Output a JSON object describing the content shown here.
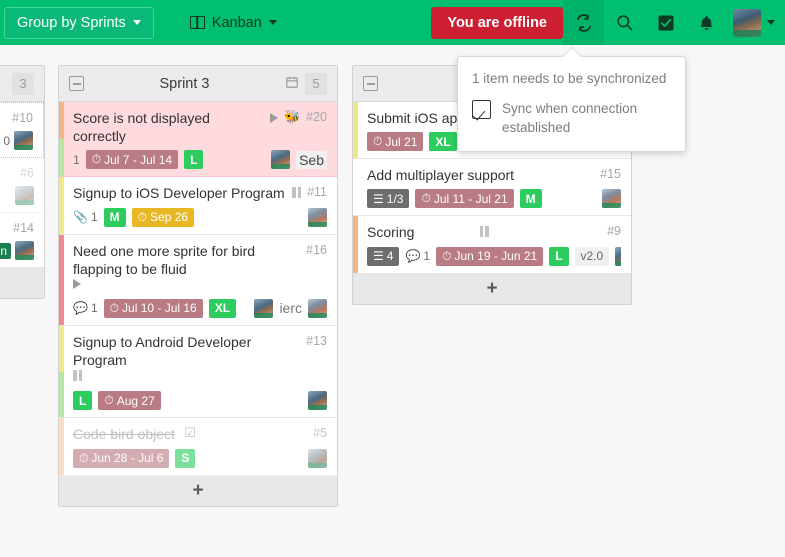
{
  "topbar": {
    "group_button": {
      "label": "Group by Sprints",
      "icon": "chevron-down-icon",
      "bg": "#0ab878"
    },
    "view_button": {
      "label": "Kanban",
      "icon": "kanban-icon"
    },
    "offline_badge": {
      "label": "You are offline",
      "bg": "#cc1f32"
    },
    "icons": [
      {
        "name": "sync-icon",
        "glyph": "↻",
        "active": true
      },
      {
        "name": "search-icon",
        "glyph": "⌕",
        "active": false
      },
      {
        "name": "tasks-checkbox-icon",
        "glyph": "☑",
        "active": false
      },
      {
        "name": "notifications-bell-icon",
        "glyph": "ὑ4",
        "active": false
      }
    ],
    "avatar": {
      "name": "user-avatar",
      "caret": "chevron-down-icon"
    },
    "accent": "#00c070"
  },
  "sync_popover": {
    "title": "1 item needs to be synchronized",
    "checkbox_label": "Sync when connection established",
    "checked": true
  },
  "columns": [
    {
      "id": "col-left",
      "title": "",
      "count": "3",
      "cards": [
        {
          "id": "#10",
          "title": "",
          "dotted": true,
          "extra": "0"
        },
        {
          "id": "#6",
          "title": "",
          "dim": true
        },
        {
          "id": "#14",
          "title": "",
          "tag": "n"
        }
      ]
    },
    {
      "id": "sprint-3",
      "title": "Sprint 3",
      "calendar_icon": "calendar-icon",
      "count": "5",
      "cards": [
        {
          "title": "Score is not displayed correctly",
          "id": "#20",
          "highlighted": true,
          "stripes": [
            "#f5b687",
            "#b5e8a0"
          ],
          "play": true,
          "bug": true,
          "comments": "1",
          "date": "Jul 7 - Jul 14",
          "date_style": "date",
          "size": "L",
          "avatars": 1,
          "assignee": "Seb"
        },
        {
          "title": "Signup to iOS Developer Program",
          "id": "#11",
          "stripes": [
            "#f0e98a"
          ],
          "pause": true,
          "attachments": "1",
          "size": "M",
          "date": "Sep 26",
          "date_style": "date-y",
          "avatars": 1
        },
        {
          "title": "Need one more sprite for bird flapping to be fluid",
          "id": "#16",
          "stripes": [
            "#f08a90"
          ],
          "play": true,
          "comments": "1",
          "date": "Jul 10 - Jul 16",
          "date_style": "date",
          "size": "XL",
          "avatars": 3,
          "assignee_fragment": "ierc"
        },
        {
          "title": "Signup to Android Developer Program",
          "id": "#13",
          "stripes": [
            "#f0e98a",
            "#b5e8a0"
          ],
          "pause": true,
          "size": "L",
          "date": "Aug 27",
          "date_style": "date",
          "avatars": 1
        },
        {
          "title": "Code bird object",
          "id": "#5",
          "done": true,
          "stripes": [
            "#f7c9a6"
          ],
          "check": true,
          "date": "Jun 28 - Jul 6",
          "date_style": "date",
          "size": "S",
          "avatars": 1
        }
      ],
      "footer_add": "+"
    },
    {
      "id": "col-two",
      "title": "",
      "count": "",
      "cards": [
        {
          "title": "Submit iOS app",
          "id": "",
          "stripes": [
            "#f0e98a"
          ],
          "date": "Jul 21",
          "date_style": "date",
          "size": "XL",
          "avatars": 0
        },
        {
          "title": "Add multiplayer support",
          "id": "#15",
          "stripes": [
            "#ffffff"
          ],
          "checklist": "1/3",
          "date": "Jul 11 - Jul 21",
          "date_style": "date",
          "size": "M",
          "avatars": 1
        },
        {
          "title": "Scoring",
          "id": "#9",
          "stripes": [
            "#f5b687"
          ],
          "pause": true,
          "checklist": "4",
          "comments": "1",
          "date": "Jun 19 - Jun 21",
          "date_style": "date",
          "size": "L",
          "version": "v2.0",
          "avatars": 1
        }
      ],
      "footer_add": "+"
    }
  ]
}
